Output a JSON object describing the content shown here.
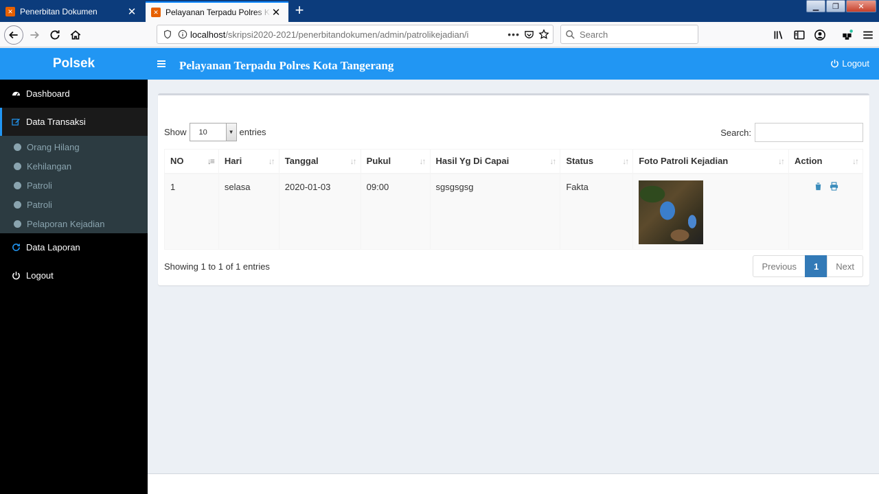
{
  "browser": {
    "tabs": [
      {
        "title": "Penerbitan Dokumen",
        "active": false
      },
      {
        "title": "Pelayanan Terpadu Polres Kota Tangerang",
        "active": true
      }
    ],
    "url_host": "localhost",
    "url_path": "/skripsi2020-2021/penerbitandokumen/admin/patrolikejadian/i",
    "search_placeholder": "Search"
  },
  "app": {
    "brand": "Polsek",
    "title": "Pelayanan Terpadu Polres Kota Tangerang",
    "logout_label": "Logout",
    "accent_color": "#2196f3"
  },
  "sidebar": {
    "dashboard": "Dashboard",
    "data_transaksi": "Data Transaksi",
    "sub_items": [
      "Orang Hilang",
      "Kehilangan",
      "Patroli",
      "Patroli",
      "Pelaporan Kejadian"
    ],
    "data_laporan": "Data Laporan",
    "logout": "Logout"
  },
  "table_controls": {
    "show_label": "Show",
    "entries_value": "10",
    "entries_label": "entries",
    "search_label": "Search:"
  },
  "table": {
    "headers": [
      "NO",
      "Hari",
      "Tanggal",
      "Pukul",
      "Hasil Yg Di Capai",
      "Status",
      "Foto Patroli Kejadian",
      "Action"
    ],
    "rows": [
      {
        "no": "1",
        "hari": "selasa",
        "tanggal": "2020-01-03",
        "pukul": "09:00",
        "hasil": "sgsgsgsg",
        "status": "Fakta"
      }
    ]
  },
  "pagination": {
    "info": "Showing 1 to 1 of 1 entries",
    "previous": "Previous",
    "page": "1",
    "next": "Next"
  }
}
